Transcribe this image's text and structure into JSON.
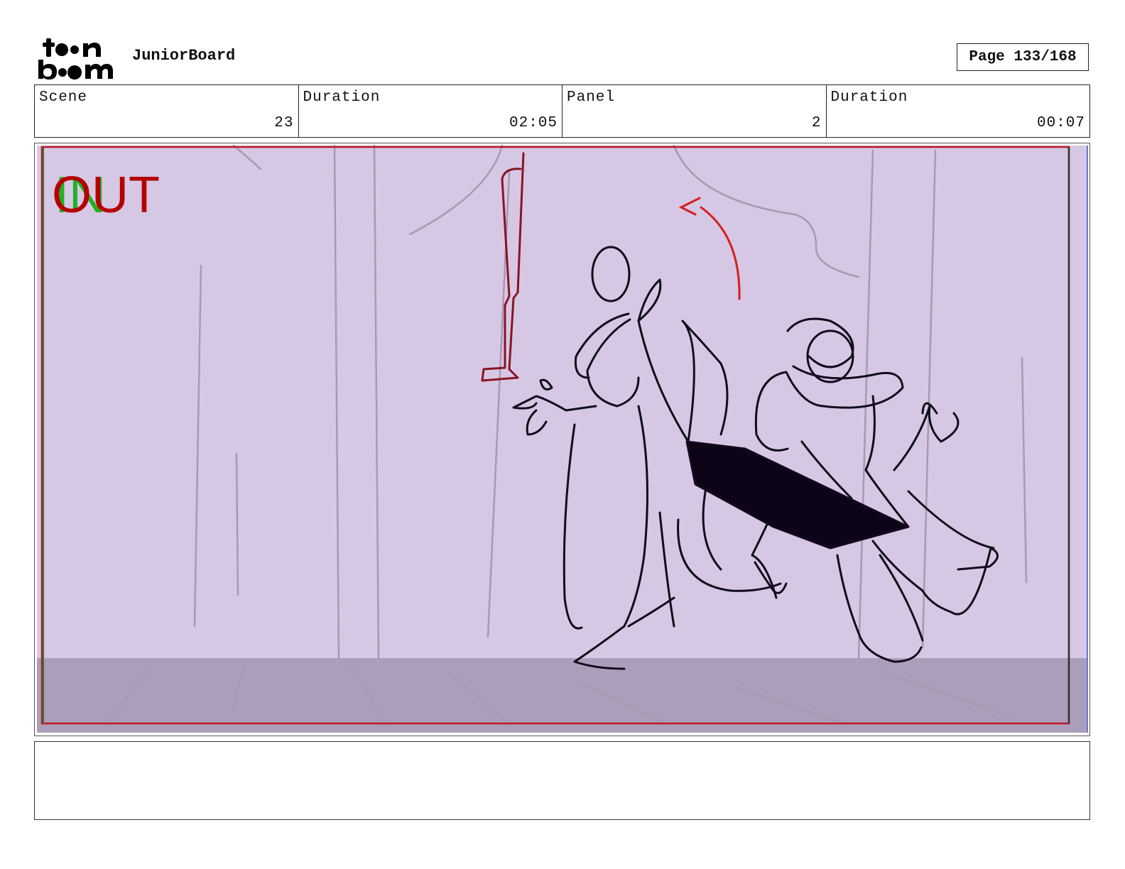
{
  "header": {
    "logo_text": "toon boom",
    "app_name": "JuniorBoard",
    "page_label": "Page 133/168"
  },
  "info": {
    "scene_label": "Scene",
    "scene_value": "23",
    "scene_duration_label": "Duration",
    "scene_duration_value": "02:05",
    "panel_label": "Panel",
    "panel_value": "2",
    "panel_duration_label": "Duration",
    "panel_duration_value": "00:07"
  },
  "panel": {
    "in_marker": "IN",
    "out_marker": "OUT",
    "background_color": "#d6c8e4",
    "floor_color": "#ab9eba",
    "safe_frame_color": "#c0182a",
    "in_color": "#22b022",
    "out_color": "#b40000"
  },
  "notes": {
    "text": ""
  }
}
